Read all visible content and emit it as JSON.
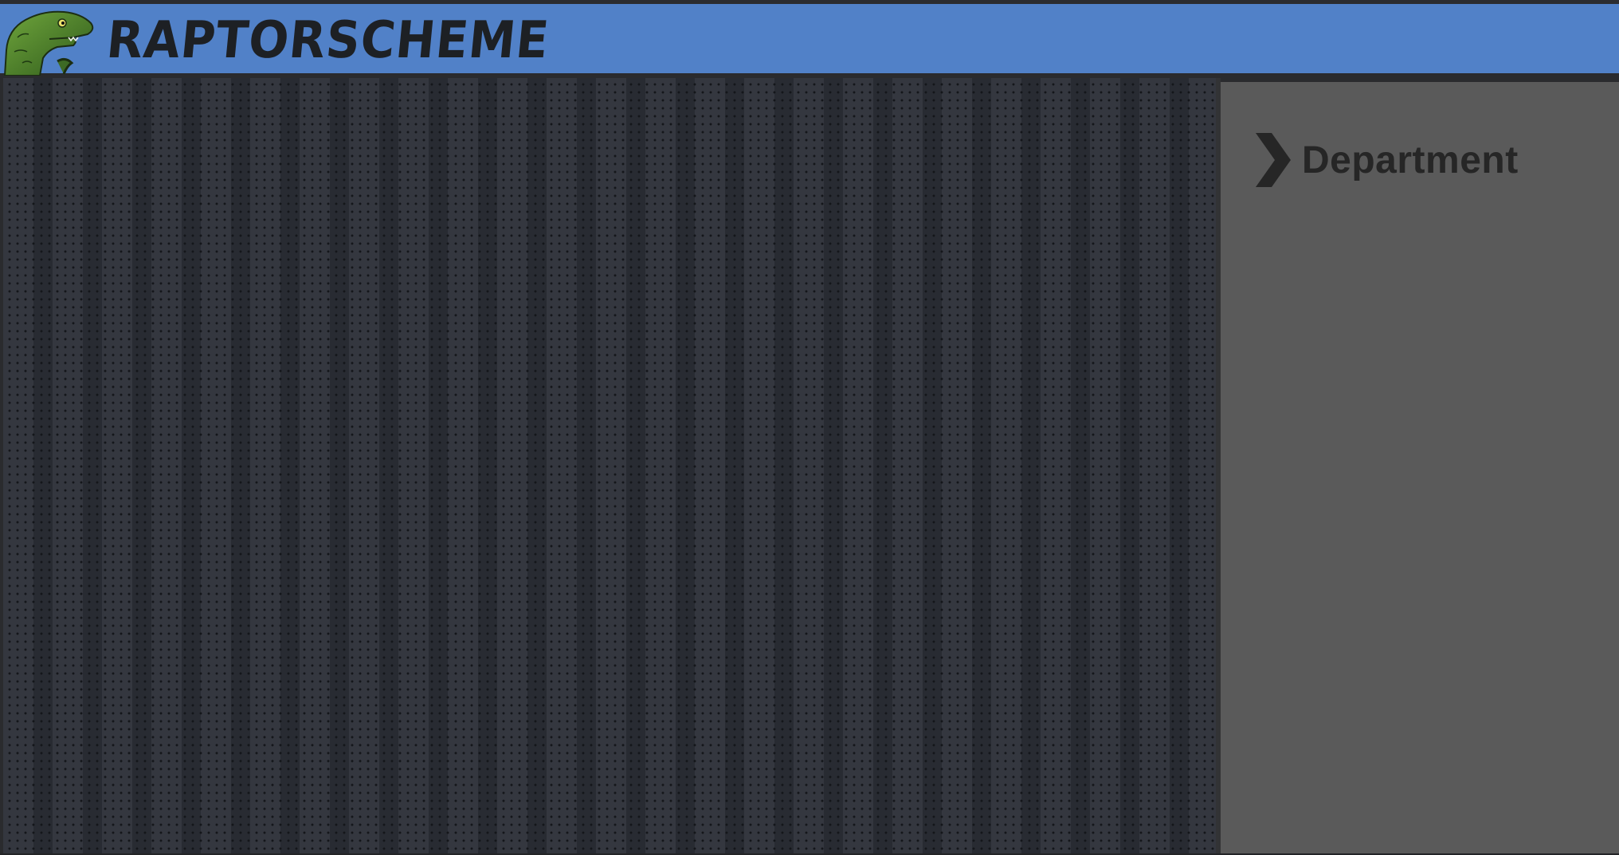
{
  "header": {
    "brand": "RAPTORSCHEME",
    "logo_icon": "raptor-logo-icon",
    "accent_color": "#5181c8"
  },
  "main": {
    "background": "perforated-metal-pattern"
  },
  "sidebar": {
    "items": [
      {
        "label": "Department",
        "icon": "chevron-right-icon"
      }
    ]
  }
}
